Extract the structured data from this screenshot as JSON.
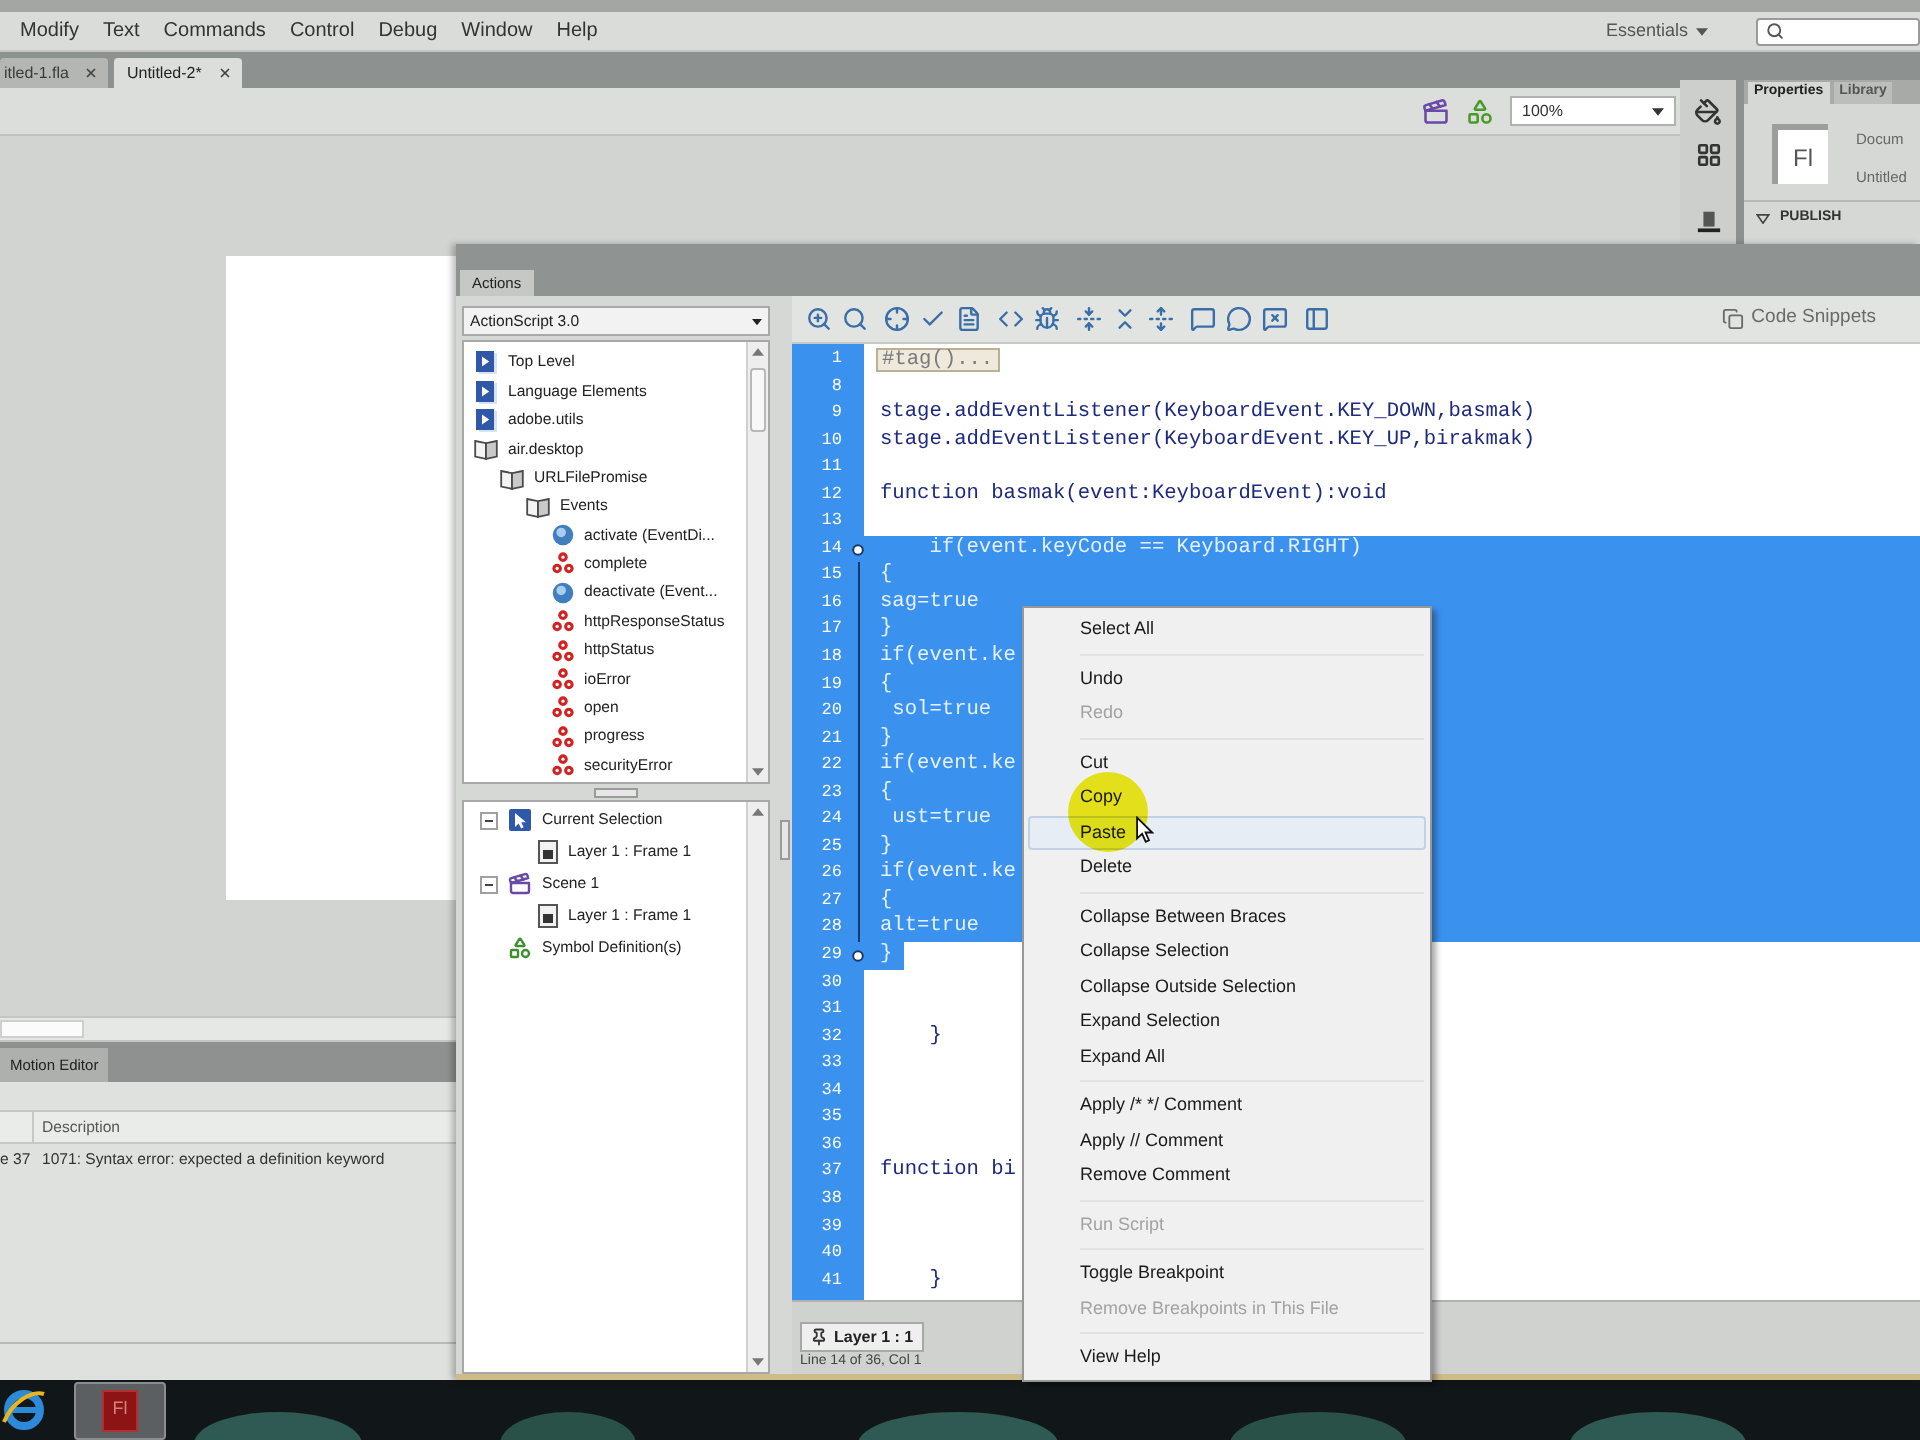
{
  "menu_bar": {
    "items": [
      "Modify",
      "Text",
      "Commands",
      "Control",
      "Debug",
      "Window",
      "Help"
    ],
    "workspace": "Essentials"
  },
  "document_tabs": [
    {
      "label": "itled-1.fla",
      "selected": false
    },
    {
      "label": "Untitled-2*",
      "selected": true
    }
  ],
  "stage_toolbar": {
    "zoom": "100%"
  },
  "properties_panel": {
    "tabs": [
      {
        "label": "Properties",
        "selected": true
      },
      {
        "label": "Library",
        "selected": false
      }
    ],
    "document_icon": "Fl",
    "document_type": "Docum",
    "document_name": "Untitled",
    "section": "PUBLISH"
  },
  "bottom_panel": {
    "tab": "Motion Editor",
    "columns": [
      "Description"
    ],
    "rows": [
      {
        "location": "e 37",
        "description": "1071: Syntax error: expected a definition keyword"
      }
    ]
  },
  "actions_panel": {
    "title": "Actions",
    "language": "ActionScript 3.0",
    "toolbox": [
      {
        "label": "Top Level",
        "kind": "package"
      },
      {
        "label": "Language Elements",
        "kind": "package"
      },
      {
        "label": "adobe.utils",
        "kind": "package"
      },
      {
        "label": "air.desktop",
        "kind": "book",
        "children": [
          {
            "label": "URLFilePromise",
            "kind": "book",
            "children": [
              {
                "label": "Events",
                "kind": "book",
                "children": [
                  {
                    "label": "activate (EventDi...",
                    "kind": "property"
                  },
                  {
                    "label": "complete",
                    "kind": "event"
                  },
                  {
                    "label": "deactivate (Event...",
                    "kind": "property"
                  },
                  {
                    "label": "httpResponseStatus",
                    "kind": "event"
                  },
                  {
                    "label": "httpStatus",
                    "kind": "event"
                  },
                  {
                    "label": "ioError",
                    "kind": "event"
                  },
                  {
                    "label": "open",
                    "kind": "event"
                  },
                  {
                    "label": "progress",
                    "kind": "event"
                  },
                  {
                    "label": "securityError",
                    "kind": "event"
                  }
                ]
              }
            ]
          }
        ]
      }
    ],
    "script_navigator": [
      {
        "label": "Current Selection",
        "kind": "selection",
        "children": [
          {
            "label": "Layer 1 : Frame 1",
            "kind": "frame"
          }
        ]
      },
      {
        "label": "Scene 1",
        "kind": "scene",
        "children": [
          {
            "label": "Layer 1 : Frame 1",
            "kind": "frame"
          }
        ]
      },
      {
        "label": "Symbol Definition(s)",
        "kind": "symbols"
      }
    ],
    "code_snippets": "Code Snippets",
    "lines": [
      {
        "number": "1",
        "kind": "collapsed",
        "text": "#tag()...",
        "selected": false
      },
      {
        "number": "8",
        "kind": "code",
        "selected": false
      },
      {
        "number": "9",
        "kind": "code",
        "text": "stage.addEventListener(KeyboardEvent.KEY_DOWN,basmak)",
        "selected": false
      },
      {
        "number": "10",
        "kind": "code",
        "text": "stage.addEventListener(KeyboardEvent.KEY_UP,birakmak)",
        "selected": false
      },
      {
        "number": "11",
        "kind": "code",
        "selected": false
      },
      {
        "number": "12",
        "kind": "code",
        "text": "function basmak(event:KeyboardEvent):void",
        "selected": false
      },
      {
        "number": "13",
        "kind": "code",
        "selected": false
      },
      {
        "number": "14",
        "kind": "code",
        "text": "    if(event.keyCode == Keyboard.RIGHT)",
        "selected": true
      },
      {
        "number": "15",
        "kind": "code",
        "text": "{",
        "selected": true
      },
      {
        "number": "16",
        "kind": "code",
        "text": "sag=true",
        "selected": true
      },
      {
        "number": "17",
        "kind": "code",
        "text": "}",
        "selected": true
      },
      {
        "number": "18",
        "kind": "code",
        "text": "if(event.ke",
        "selected": true
      },
      {
        "number": "19",
        "kind": "code",
        "text": "{",
        "selected": true
      },
      {
        "number": "20",
        "kind": "code",
        "text": " sol=true",
        "selected": true
      },
      {
        "number": "21",
        "kind": "code",
        "text": "}",
        "selected": true
      },
      {
        "number": "22",
        "kind": "code",
        "text": "if(event.ke",
        "selected": true
      },
      {
        "number": "23",
        "kind": "code",
        "text": "{",
        "selected": true
      },
      {
        "number": "24",
        "kind": "code",
        "text": " ust=true",
        "selected": true
      },
      {
        "number": "25",
        "kind": "code",
        "text": "}",
        "selected": true
      },
      {
        "number": "26",
        "kind": "code",
        "text": "if(event.ke",
        "selected": true
      },
      {
        "number": "27",
        "kind": "code",
        "text": "{",
        "selected": true
      },
      {
        "number": "28",
        "kind": "code",
        "text": "alt=true",
        "selected": true
      },
      {
        "number": "29",
        "kind": "code",
        "text": "}",
        "selected": true
      },
      {
        "number": "30",
        "kind": "code",
        "selected": false
      },
      {
        "number": "31",
        "kind": "code",
        "selected": false
      },
      {
        "number": "32",
        "kind": "code",
        "text": "    }",
        "selected": false
      },
      {
        "number": "33",
        "kind": "code",
        "selected": false
      },
      {
        "number": "34",
        "kind": "code",
        "selected": false
      },
      {
        "number": "35",
        "kind": "code",
        "selected": false
      },
      {
        "number": "36",
        "kind": "code",
        "selected": false
      },
      {
        "number": "37",
        "kind": "code",
        "text": "function bi",
        "selected": false
      },
      {
        "number": "38",
        "kind": "code",
        "selected": false
      },
      {
        "number": "39",
        "kind": "code",
        "selected": false
      },
      {
        "number": "40",
        "kind": "code",
        "selected": false
      },
      {
        "number": "41",
        "kind": "code",
        "text": "    }",
        "selected": false
      }
    ],
    "script_tab": "Layer 1 : 1",
    "status": "Line 14 of 36, Col 1"
  },
  "context_menu": [
    {
      "kind": "item",
      "label": "Select All",
      "disabled": false,
      "selected": false
    },
    {
      "kind": "separator"
    },
    {
      "kind": "item",
      "label": "Undo",
      "disabled": false,
      "selected": false
    },
    {
      "kind": "item",
      "label": "Redo",
      "disabled": true,
      "selected": false
    },
    {
      "kind": "separator"
    },
    {
      "kind": "item",
      "label": "Cut",
      "disabled": false,
      "selected": false
    },
    {
      "kind": "item",
      "label": "Copy",
      "disabled": false,
      "selected": false
    },
    {
      "kind": "item",
      "label": "Paste",
      "disabled": false,
      "selected": true
    },
    {
      "kind": "item",
      "label": "Delete",
      "disabled": false,
      "selected": false
    },
    {
      "kind": "separator"
    },
    {
      "kind": "item",
      "label": "Collapse Between Braces",
      "disabled": false,
      "selected": false
    },
    {
      "kind": "item",
      "label": "Collapse Selection",
      "disabled": false,
      "selected": false
    },
    {
      "kind": "item",
      "label": "Collapse Outside Selection",
      "disabled": false,
      "selected": false
    },
    {
      "kind": "item",
      "label": "Expand Selection",
      "disabled": false,
      "selected": false
    },
    {
      "kind": "item",
      "label": "Expand All",
      "disabled": false,
      "selected": false
    },
    {
      "kind": "separator"
    },
    {
      "kind": "item",
      "label": "Apply /* */ Comment",
      "disabled": false,
      "selected": false
    },
    {
      "kind": "item",
      "label": "Apply // Comment",
      "disabled": false,
      "selected": false
    },
    {
      "kind": "item",
      "label": "Remove Comment",
      "disabled": false,
      "selected": false
    },
    {
      "kind": "separator"
    },
    {
      "kind": "item",
      "label": "Run Script",
      "disabled": true,
      "selected": false
    },
    {
      "kind": "separator"
    },
    {
      "kind": "item",
      "label": "Toggle Breakpoint",
      "disabled": false,
      "selected": false
    },
    {
      "kind": "item",
      "label": "Remove Breakpoints in This File",
      "disabled": true,
      "selected": false
    },
    {
      "kind": "separator"
    },
    {
      "kind": "item",
      "label": "View Help",
      "disabled": false,
      "selected": false
    }
  ],
  "taskbar": [
    {
      "kind": "browser"
    },
    {
      "kind": "flash",
      "label": "Fl"
    }
  ]
}
